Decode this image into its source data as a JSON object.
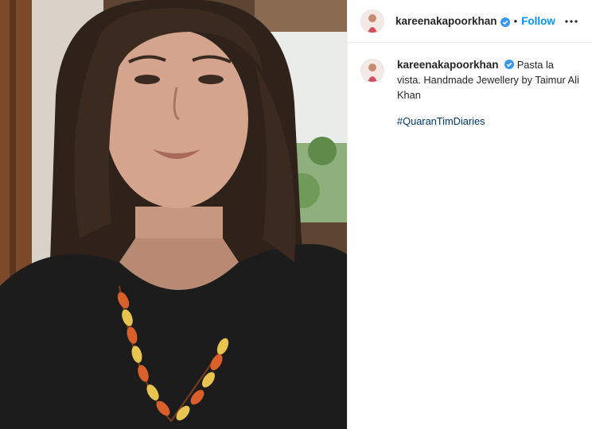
{
  "post": {
    "username": "kareenakapoorkhan",
    "follow_label": "Follow",
    "separator": "•",
    "caption": {
      "text": "Pasta la vista. Handmade Jewellery by Taimur Ali Khan",
      "hashtag": "#QuaranTimDiaries"
    }
  },
  "colors": {
    "link": "#0095f6",
    "hashtag": "#00376b",
    "verified": "#3897f0",
    "text": "#262626"
  },
  "icons": {
    "verified": "verified-badge-icon",
    "more": "more-options-icon"
  }
}
